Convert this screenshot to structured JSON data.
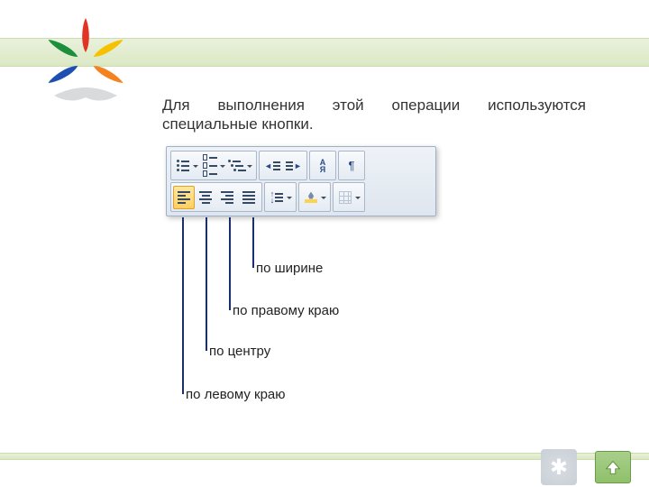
{
  "description": "Для выполнения этой операции используются специальные кнопки.",
  "labels": {
    "justify": "по ширине",
    "right": "по правому краю",
    "center": "по центру",
    "left": "по левому краю"
  },
  "toolbar": {
    "row1": [
      "bullet-list",
      "numbered-list",
      "multilevel-list",
      "decrease-indent",
      "increase-indent",
      "sort",
      "paragraph-marks"
    ],
    "row2": [
      "align-left",
      "align-center",
      "align-right",
      "align-justify",
      "line-spacing",
      "shading",
      "borders"
    ]
  },
  "colors": {
    "band": "#dbe8c4",
    "accent": "#1a2f6e"
  }
}
